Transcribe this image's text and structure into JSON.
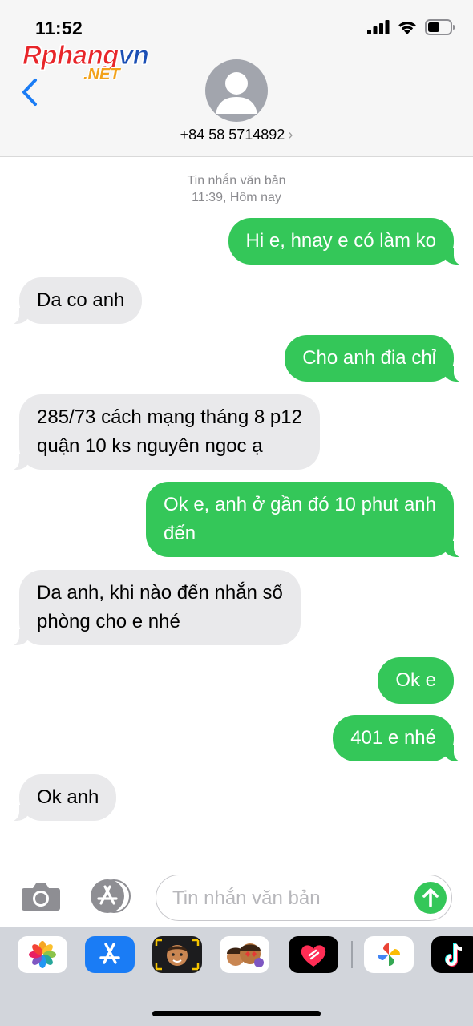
{
  "status_bar": {
    "time": "11:52",
    "icons": [
      "signal-icon",
      "wifi-icon",
      "battery-icon"
    ]
  },
  "watermark": {
    "main_red": "Rphang",
    "main_blue": "vn",
    "sub": ".NET"
  },
  "header": {
    "contact": "+84 58 5714892",
    "chevron": "›"
  },
  "timestamp": {
    "line1": "Tin nhắn văn bản",
    "line2": "11:39, Hôm nay"
  },
  "messages": [
    {
      "from": "me",
      "text": "Hi e, hnay e có làm ko"
    },
    {
      "from": "them",
      "text": "Da co anh"
    },
    {
      "from": "me",
      "text": "Cho anh đia chỉ"
    },
    {
      "from": "them",
      "line1": "285/73 cách mạng tháng 8 p12",
      "line2": "quận 10 ks nguyên ngoc ạ"
    },
    {
      "from": "me",
      "line1": "Ok e, anh ở gần đó 10 phut anh",
      "line2": "đến"
    },
    {
      "from": "them",
      "line1": "Da anh, khi nào đến nhắn số",
      "line2": "phòng cho e nhé"
    },
    {
      "from": "me",
      "text": "Ok e"
    },
    {
      "from": "me",
      "text": "401 e nhé"
    },
    {
      "from": "them",
      "text": "Ok anh"
    }
  ],
  "input": {
    "placeholder": "Tin nhắn văn bản"
  },
  "drawer": {
    "apps": [
      "photos-app-icon",
      "app-store-icon",
      "memoji-icon",
      "animoji-stickers-icon",
      "digital-touch-icon",
      "google-photos-icon",
      "tiktok-icon"
    ]
  },
  "colors": {
    "sent_bubble": "#34c759",
    "received_bubble": "#e9e9eb",
    "link_blue": "#1a7cf5"
  }
}
